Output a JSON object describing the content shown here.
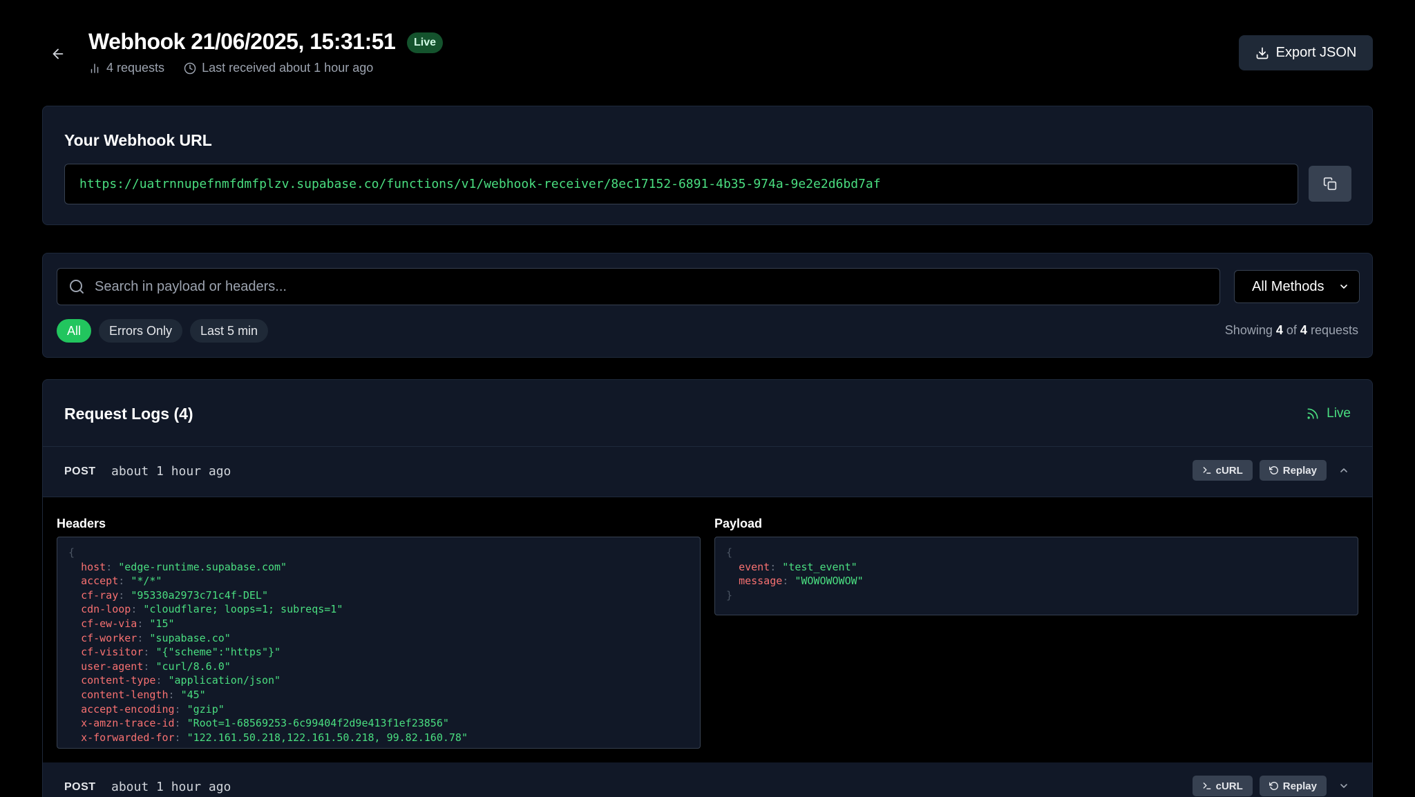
{
  "header": {
    "title": "Webhook 21/06/2025, 15:31:51",
    "badge": "Live",
    "request_count": "4 requests",
    "last_received": "Last received about 1 hour ago",
    "export_label": "Export JSON"
  },
  "url_card": {
    "title": "Your Webhook URL",
    "url": "https://uatrnnupefnmfdmfplzv.supabase.co/functions/v1/webhook-receiver/8ec17152-6891-4b35-974a-9e2e2d6bd7af"
  },
  "filters": {
    "search_placeholder": "Search in payload or headers...",
    "method_selected": "All Methods",
    "chips": [
      "All",
      "Errors Only",
      "Last 5 min"
    ],
    "showing_prefix": "Showing",
    "showing_count": "4",
    "showing_of": "of",
    "showing_total": "4",
    "showing_suffix": "requests"
  },
  "logs": {
    "title": "Request Logs (4)",
    "live_label": "Live",
    "curl_label": "cURL",
    "replay_label": "Replay",
    "headers_title": "Headers",
    "payload_title": "Payload",
    "rows": [
      {
        "method": "POST",
        "time": "about 1 hour ago"
      },
      {
        "method": "POST",
        "time": "about 1 hour ago"
      }
    ],
    "headers": [
      {
        "key": "host",
        "value": "\"edge-runtime.supabase.com\""
      },
      {
        "key": "accept",
        "value": "\"*/*\""
      },
      {
        "key": "cf-ray",
        "value": "\"95330a2973c71c4f-DEL\""
      },
      {
        "key": "cdn-loop",
        "value": "\"cloudflare; loops=1; subreqs=1\""
      },
      {
        "key": "cf-ew-via",
        "value": "\"15\""
      },
      {
        "key": "cf-worker",
        "value": "\"supabase.co\""
      },
      {
        "key": "cf-visitor",
        "value": "\"{\"scheme\":\"https\"}\""
      },
      {
        "key": "user-agent",
        "value": "\"curl/8.6.0\""
      },
      {
        "key": "content-type",
        "value": "\"application/json\""
      },
      {
        "key": "content-length",
        "value": "\"45\""
      },
      {
        "key": "accept-encoding",
        "value": "\"gzip\""
      },
      {
        "key": "x-amzn-trace-id",
        "value": "\"Root=1-68569253-6c99404f2d9e413f1ef23856\""
      },
      {
        "key": "x-forwarded-for",
        "value": "\"122.161.50.218,122.161.50.218, 99.82.160.78\""
      }
    ],
    "payload": [
      {
        "key": "event",
        "value": "\"test_event\""
      },
      {
        "key": "message",
        "value": "\"WOWOWOWOW\""
      }
    ]
  },
  "colors": {
    "accent_green": "#22c55e",
    "json_key": "#f87171",
    "json_value": "#4ade80",
    "card_bg": "#111827"
  },
  "icons": [
    "arrow-left-icon",
    "bar-chart-icon",
    "clock-icon",
    "download-icon",
    "copy-icon",
    "search-icon",
    "chevron-down-icon",
    "rss-icon",
    "terminal-icon",
    "rotate-ccw-icon",
    "chevron-up-icon"
  ]
}
